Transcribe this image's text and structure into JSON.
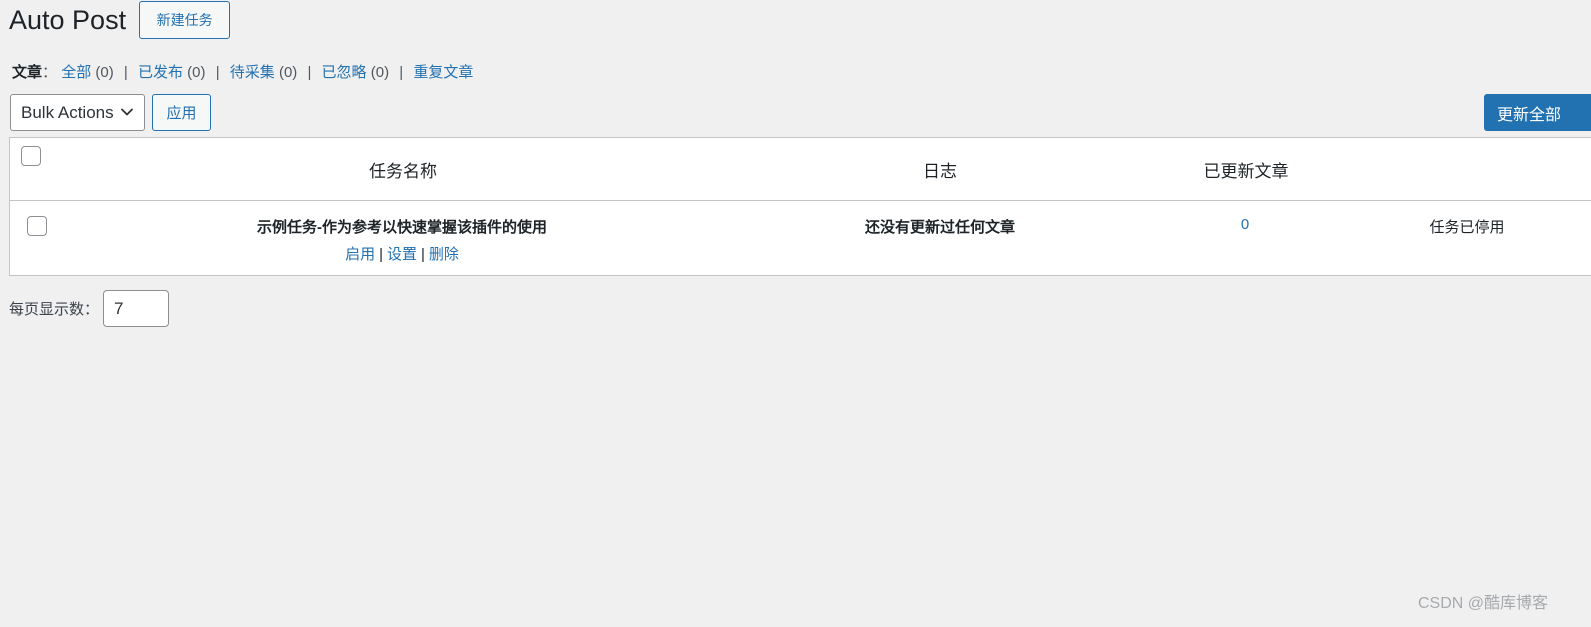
{
  "header": {
    "title": "Auto Post",
    "new_task_label": "新建任务"
  },
  "filters": {
    "label": "文章",
    "colon": "：",
    "items": [
      {
        "label": "全部",
        "count": "(0)"
      },
      {
        "label": "已发布",
        "count": "(0)"
      },
      {
        "label": "待采集",
        "count": "(0)"
      },
      {
        "label": "已忽略",
        "count": "(0)"
      },
      {
        "label": "重复文章",
        "count": ""
      }
    ],
    "separator": "|"
  },
  "toolbar": {
    "bulk_actions_selected": "Bulk Actions",
    "apply_label": "应用",
    "update_all_label": "更新全部"
  },
  "table": {
    "columns": [
      "任务名称",
      "日志",
      "已更新文章",
      ""
    ],
    "rows": [
      {
        "task_name": "示例任务-作为参考以快速掌握该插件的使用",
        "log": "还没有更新过任何文章",
        "updated_count": "0",
        "status": "任务已停用",
        "actions": [
          "启用",
          "设置",
          "删除"
        ]
      }
    ]
  },
  "pagination": {
    "per_page_label": "每页显示数：",
    "per_page_value": "7"
  },
  "watermark": "CSDN @酷库博客",
  "colors": {
    "accent": "#2271b1",
    "background": "#f0f0f1",
    "border": "#c3c4c7"
  }
}
